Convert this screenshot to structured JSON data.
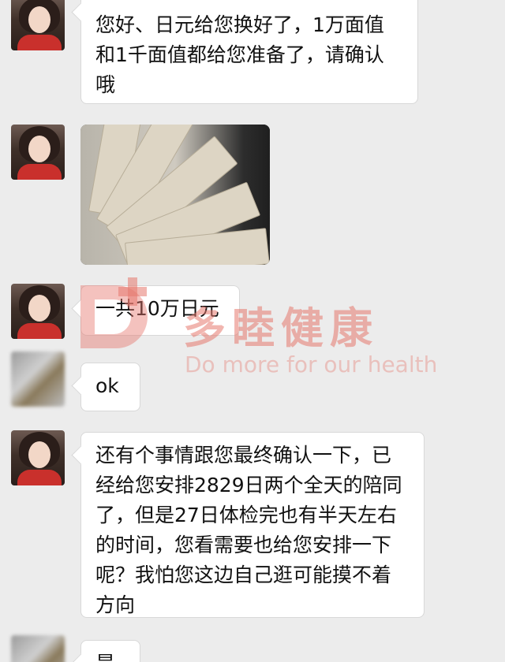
{
  "messages": [
    {
      "text": "您好、日元给您换好了，1万面值和1千面值都给您准备了，请确认哦"
    },
    {
      "image": "banknote-fan-photo"
    },
    {
      "text": "一共10万日元"
    },
    {
      "text": "ok"
    },
    {
      "text": "还有个事情跟您最终确认一下，已经给您安排2829日两个全天的陪同了，但是27日体检完也有半天左右的时间，您看需要也给您安排一下呢？我怕您这边自己逛可能摸不着方向"
    },
    {
      "text": "是"
    }
  ],
  "watermark": {
    "title": "多睦健康",
    "subtitle": "Do more for our health",
    "color": "#e6786e"
  }
}
